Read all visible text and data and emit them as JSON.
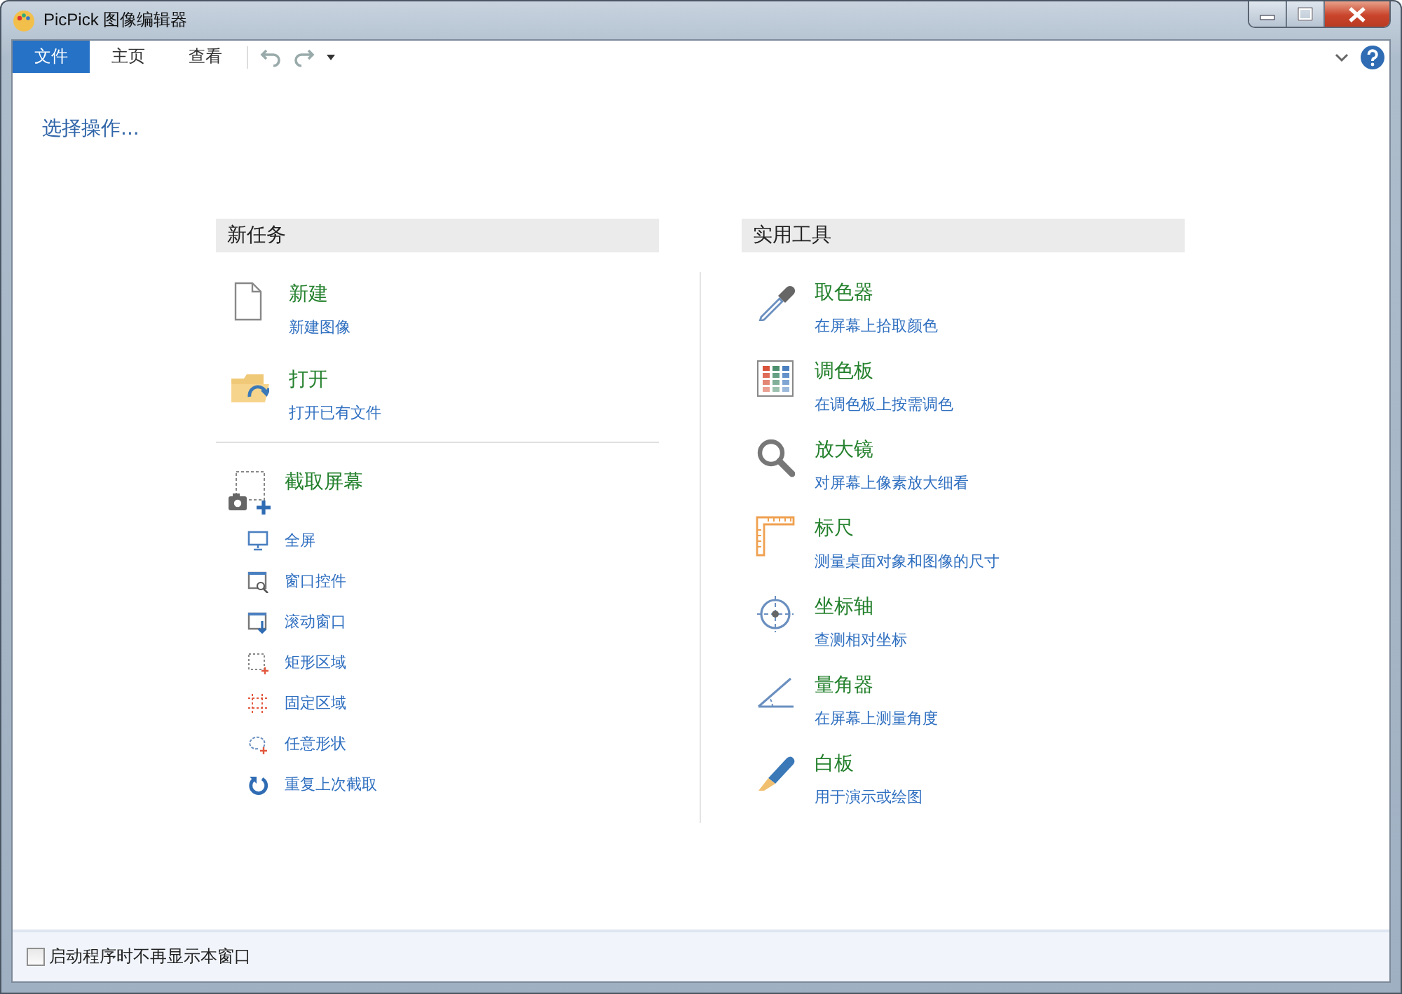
{
  "window": {
    "title": "PicPick 图像编辑器"
  },
  "tabs": [
    {
      "label": "文件",
      "selected": true
    },
    {
      "label": "主页",
      "selected": false
    },
    {
      "label": "查看",
      "selected": false
    }
  ],
  "heading": "选择操作...",
  "new_task": {
    "title": "新任务",
    "items": [
      {
        "title": "新建",
        "subtitle": "新建图像"
      },
      {
        "title": "打开",
        "subtitle": "打开已有文件"
      }
    ],
    "capture": {
      "title": "截取屏幕",
      "items": [
        "全屏",
        "窗口控件",
        "滚动窗口",
        "矩形区域",
        "固定区域",
        "任意形状",
        "重复上次截取"
      ]
    }
  },
  "tools": {
    "title": "实用工具",
    "items": [
      {
        "title": "取色器",
        "subtitle": "在屏幕上拾取颜色"
      },
      {
        "title": "调色板",
        "subtitle": "在调色板上按需调色"
      },
      {
        "title": "放大镜",
        "subtitle": "对屏幕上像素放大细看"
      },
      {
        "title": "标尺",
        "subtitle": "测量桌面对象和图像的尺寸"
      },
      {
        "title": "坐标轴",
        "subtitle": "查测相对坐标"
      },
      {
        "title": "量角器",
        "subtitle": "在屏幕上测量角度"
      },
      {
        "title": "白板",
        "subtitle": "用于演示或绘图"
      }
    ]
  },
  "footer": {
    "label": "启动程序时不再显示本窗口",
    "checked": false
  }
}
